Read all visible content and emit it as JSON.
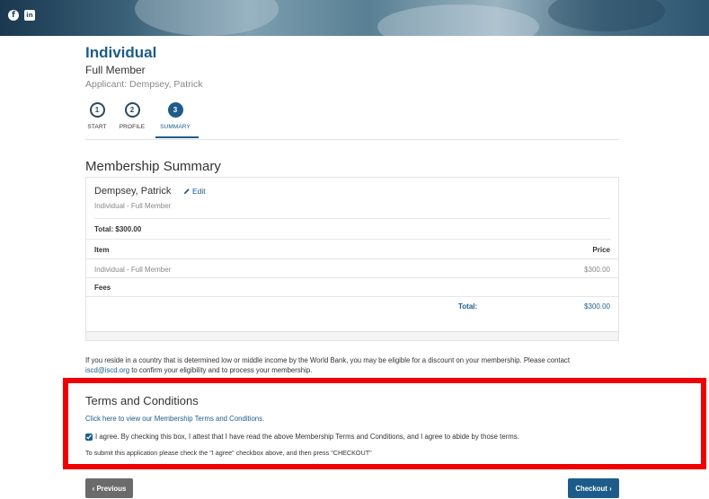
{
  "header": {
    "social_icons": [
      "facebook-icon",
      "linkedin-icon"
    ],
    "facebook_glyph": "f",
    "linkedin_glyph": "in"
  },
  "page": {
    "title": "Individual",
    "subtitle": "Full Member",
    "applicant": "Applicant: Dempsey, Patrick"
  },
  "steps": [
    {
      "number": "1",
      "label": "START",
      "active": false
    },
    {
      "number": "2",
      "label": "PROFILE",
      "active": false
    },
    {
      "number": "3",
      "label": "SUMMARY",
      "active": true
    }
  ],
  "summary": {
    "section_title": "Membership Summary",
    "member_name": "Dempsey, Patrick",
    "edit_label": "Edit",
    "member_type": "Individual - Full Member",
    "total_top": "Total: $300.00",
    "columns": {
      "item": "Item",
      "price": "Price"
    },
    "rows": [
      {
        "item": "Individual - Full Member",
        "price": "$300.00"
      }
    ],
    "fees_label": "Fees",
    "total_label": "Total:",
    "total_value": "$300.00"
  },
  "discount": {
    "text_before": "If you reside in a country that is determined low or middle income by the World Bank, you may be eligible for a discount on your membership. Please contact ",
    "email": "iscd@iscd.org",
    "text_after": " to confirm your eligibility and to process your membership."
  },
  "terms": {
    "title": "Terms and Conditions",
    "link_text": "Click here to view our Membership Terms and Conditions.",
    "agree_text": "I agree. By checking this box, I attest that I have read the above Membership Terms and Conditions, and I agree to abide by those terms.",
    "agree_checked": true,
    "submit_note": "To submit this application please check the \"I agree\" checkbox above, and then press \"CHECKOUT\""
  },
  "nav": {
    "previous_label": "Previous",
    "checkout_label": "Checkout",
    "previous_chevron": "‹",
    "checkout_chevron": "›"
  },
  "colors": {
    "accent": "#1d5c8a",
    "highlight_frame": "#f00000",
    "previous_button": "#6b6b6b"
  }
}
